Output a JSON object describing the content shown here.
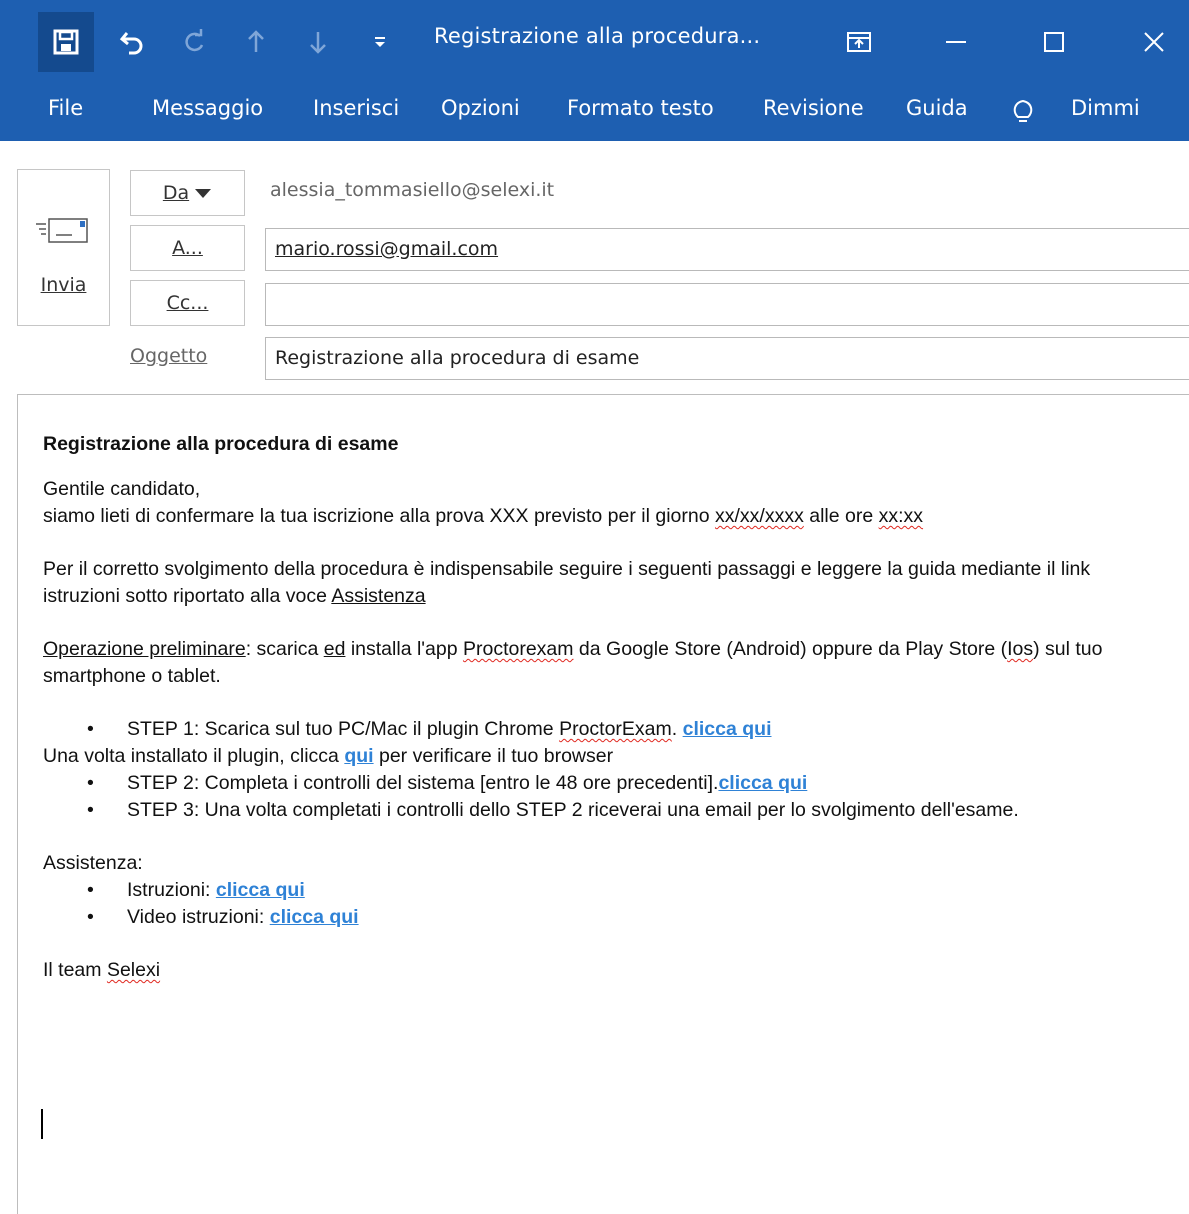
{
  "window": {
    "title": "Registrazione alla procedura...",
    "icons": [
      "save-icon",
      "undo-icon",
      "redo-icon",
      "move-up-icon",
      "move-down-icon",
      "customize-qat-icon",
      "ribbon-display-icon",
      "minimize-icon",
      "maximize-icon",
      "close-icon"
    ]
  },
  "ribbon": {
    "tabs": [
      "File",
      "Messaggio",
      "Inserisci",
      "Opzioni",
      "Formato testo",
      "Revisione",
      "Guida",
      "Dimmi"
    ]
  },
  "header": {
    "send_label": "Invia",
    "from_label": "Da",
    "from_address": "alessia_tommasiello@selexi.it",
    "to_label": "A...",
    "to_value": "mario.rossi@gmail.com",
    "cc_label": "Cc...",
    "cc_value": "",
    "subject_label": "Oggetto",
    "subject_value": "Registrazione alla procedura di esame"
  },
  "mail": {
    "heading": "Registrazione alla procedura di esame",
    "greeting": "Gentile candidato,",
    "confirm_text": "siamo lieti di confermare la tua iscrizione alla prova XXX previsto per il giorno ",
    "confirm_date": "xx/xx/xxxx",
    "confirm_mid": " alle ore ",
    "confirm_time": "xx:xx",
    "procedure_text": "Per il corretto svolgimento della procedura è indispensabile seguire i seguenti passaggi e leggere la guida mediante il link istruzioni sotto riportato alla voce ",
    "procedure_link": "Assistenza",
    "prelim_label": "Operazione preliminare",
    "prelim_a": ": scarica ",
    "prelim_ed": "ed",
    "prelim_b": " installa l'app ",
    "prelim_app": "Proctorexam",
    "prelim_c": " da Google Store (Android) oppure da Play Store (",
    "prelim_ios": "Ios",
    "prelim_d": ") sul tuo smartphone o tablet.",
    "step1_text": "STEP 1: Scarica sul tuo PC/Mac il plugin Chrome ",
    "step1_brand": "ProctorExam",
    "step1_after": ". ",
    "step1_link": "clicca qui",
    "plugin_a": "Una volta installato il plugin, clicca ",
    "plugin_link": "qui",
    "plugin_b": " per verificare il tuo browser",
    "step2_text": "STEP 2: Completa i controlli del sistema [entro le 48 ore precedenti].",
    "step2_link": "clicca qui",
    "step3_text": "STEP 3: Una volta completati i controlli dello STEP 2 riceverai una email per lo svolgimento dell'esame.",
    "assist_label": "Assistenza:",
    "instr_label": "Istruzioni: ",
    "instr_link": "clicca qui",
    "video_label": "Video istruzioni: ",
    "video_link": "clicca qui",
    "sign_a": "Il team ",
    "sign_name": "Selexi"
  }
}
